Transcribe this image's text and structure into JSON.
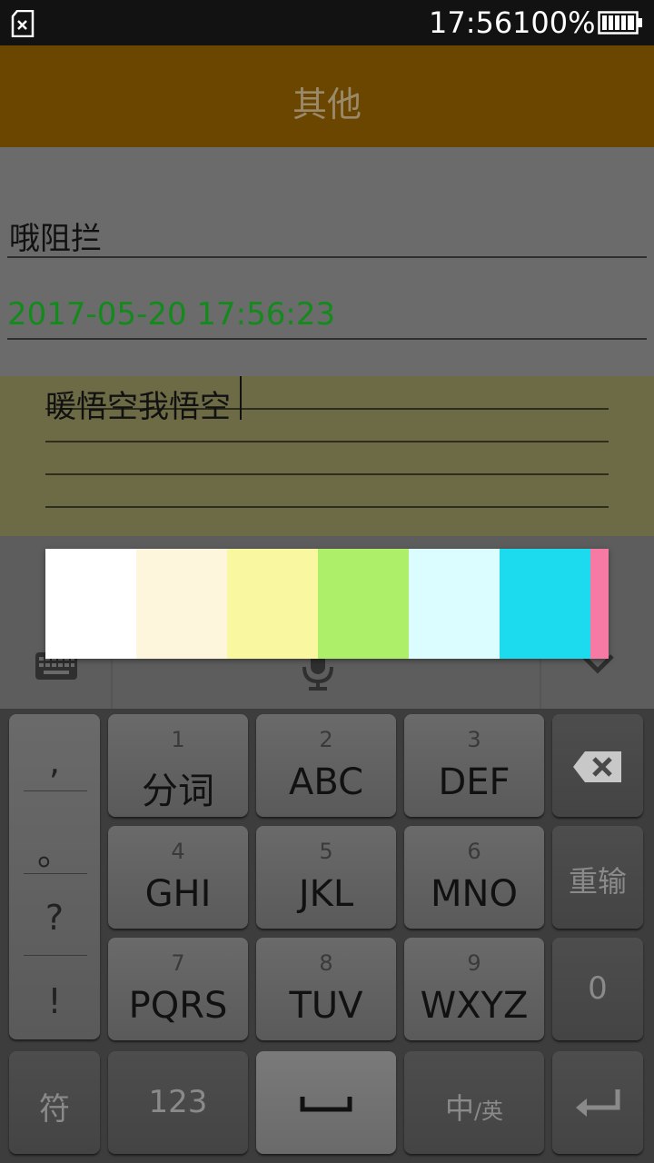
{
  "status_bar": {
    "time": "17:56",
    "battery_percent": "100%",
    "battery_level": 1.0
  },
  "header": {
    "title": "其他"
  },
  "form": {
    "title_value": "哦阻拦",
    "date_value": "2017-05-20 17:56:23"
  },
  "note": {
    "content": "暖悟空我悟空"
  },
  "palette": {
    "colors": [
      "#ffffff",
      "#fef6dc",
      "#faf7a1",
      "#adef68",
      "#dcfdff",
      "#1cdbef",
      "#f77aa5"
    ]
  },
  "keyboard": {
    "punctuation": [
      ",",
      "。",
      "?",
      "!"
    ],
    "rows": [
      [
        {
          "num": "1",
          "label": "分词"
        },
        {
          "num": "2",
          "label": "ABC"
        },
        {
          "num": "3",
          "label": "DEF"
        }
      ],
      [
        {
          "num": "4",
          "label": "GHI"
        },
        {
          "num": "5",
          "label": "JKL"
        },
        {
          "num": "6",
          "label": "MNO"
        }
      ],
      [
        {
          "num": "7",
          "label": "PQRS"
        },
        {
          "num": "8",
          "label": "TUV"
        },
        {
          "num": "9",
          "label": "WXYZ"
        }
      ]
    ],
    "reinput_label": "重输",
    "zero_label": "0",
    "symbol_label": "符",
    "numeric_label": "123",
    "lang_main": "中",
    "lang_sub": "/英"
  }
}
